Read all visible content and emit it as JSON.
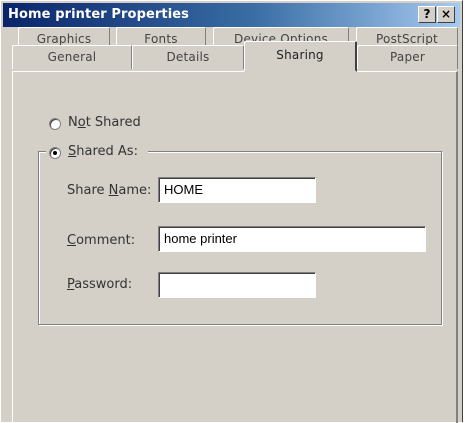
{
  "window": {
    "title": "Home printer Properties",
    "help_label": "?",
    "close_label": "×"
  },
  "tabs": {
    "back_row": [
      {
        "label": "Graphics"
      },
      {
        "label": "Fonts"
      },
      {
        "label": "Device Options"
      },
      {
        "label": "PostScript"
      }
    ],
    "front_row": [
      {
        "label": "General"
      },
      {
        "label": "Details"
      },
      {
        "label": "Sharing",
        "active": true
      },
      {
        "label": "Paper"
      }
    ]
  },
  "sharing": {
    "not_shared": {
      "pre": "N",
      "mnemonic": "o",
      "post": "t Shared",
      "selected": false
    },
    "shared_as": {
      "pre": "",
      "mnemonic": "S",
      "post": "hared As:",
      "selected": true
    },
    "share_name": {
      "pre": "Share ",
      "mnemonic": "N",
      "post": "ame:",
      "value": "HOME"
    },
    "comment": {
      "pre": "",
      "mnemonic": "C",
      "post": "omment:",
      "value": "home printer"
    },
    "password": {
      "pre": "",
      "mnemonic": "P",
      "post": "assword:",
      "value": ""
    }
  }
}
